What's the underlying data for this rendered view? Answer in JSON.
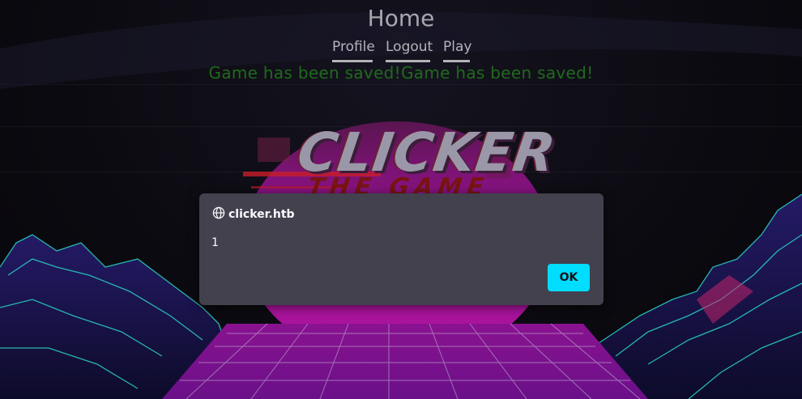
{
  "page": {
    "title": "Home"
  },
  "nav": {
    "profile": "Profile",
    "logout": "Logout",
    "play": "Play"
  },
  "status": {
    "message": "Game has been saved!Game has been saved!"
  },
  "logo": {
    "title": "CLICKER",
    "subtitle": "THE GAME"
  },
  "dialog": {
    "origin": "clicker.htb",
    "message": "1",
    "ok_label": "OK",
    "icon": "globe-icon"
  },
  "colors": {
    "accent": "#00ddff",
    "status_green": "#1f6b1c",
    "dialog_bg": "#42414d",
    "sun_magenta": "#a3119e",
    "grid_cyan": "#2ad4c6"
  }
}
